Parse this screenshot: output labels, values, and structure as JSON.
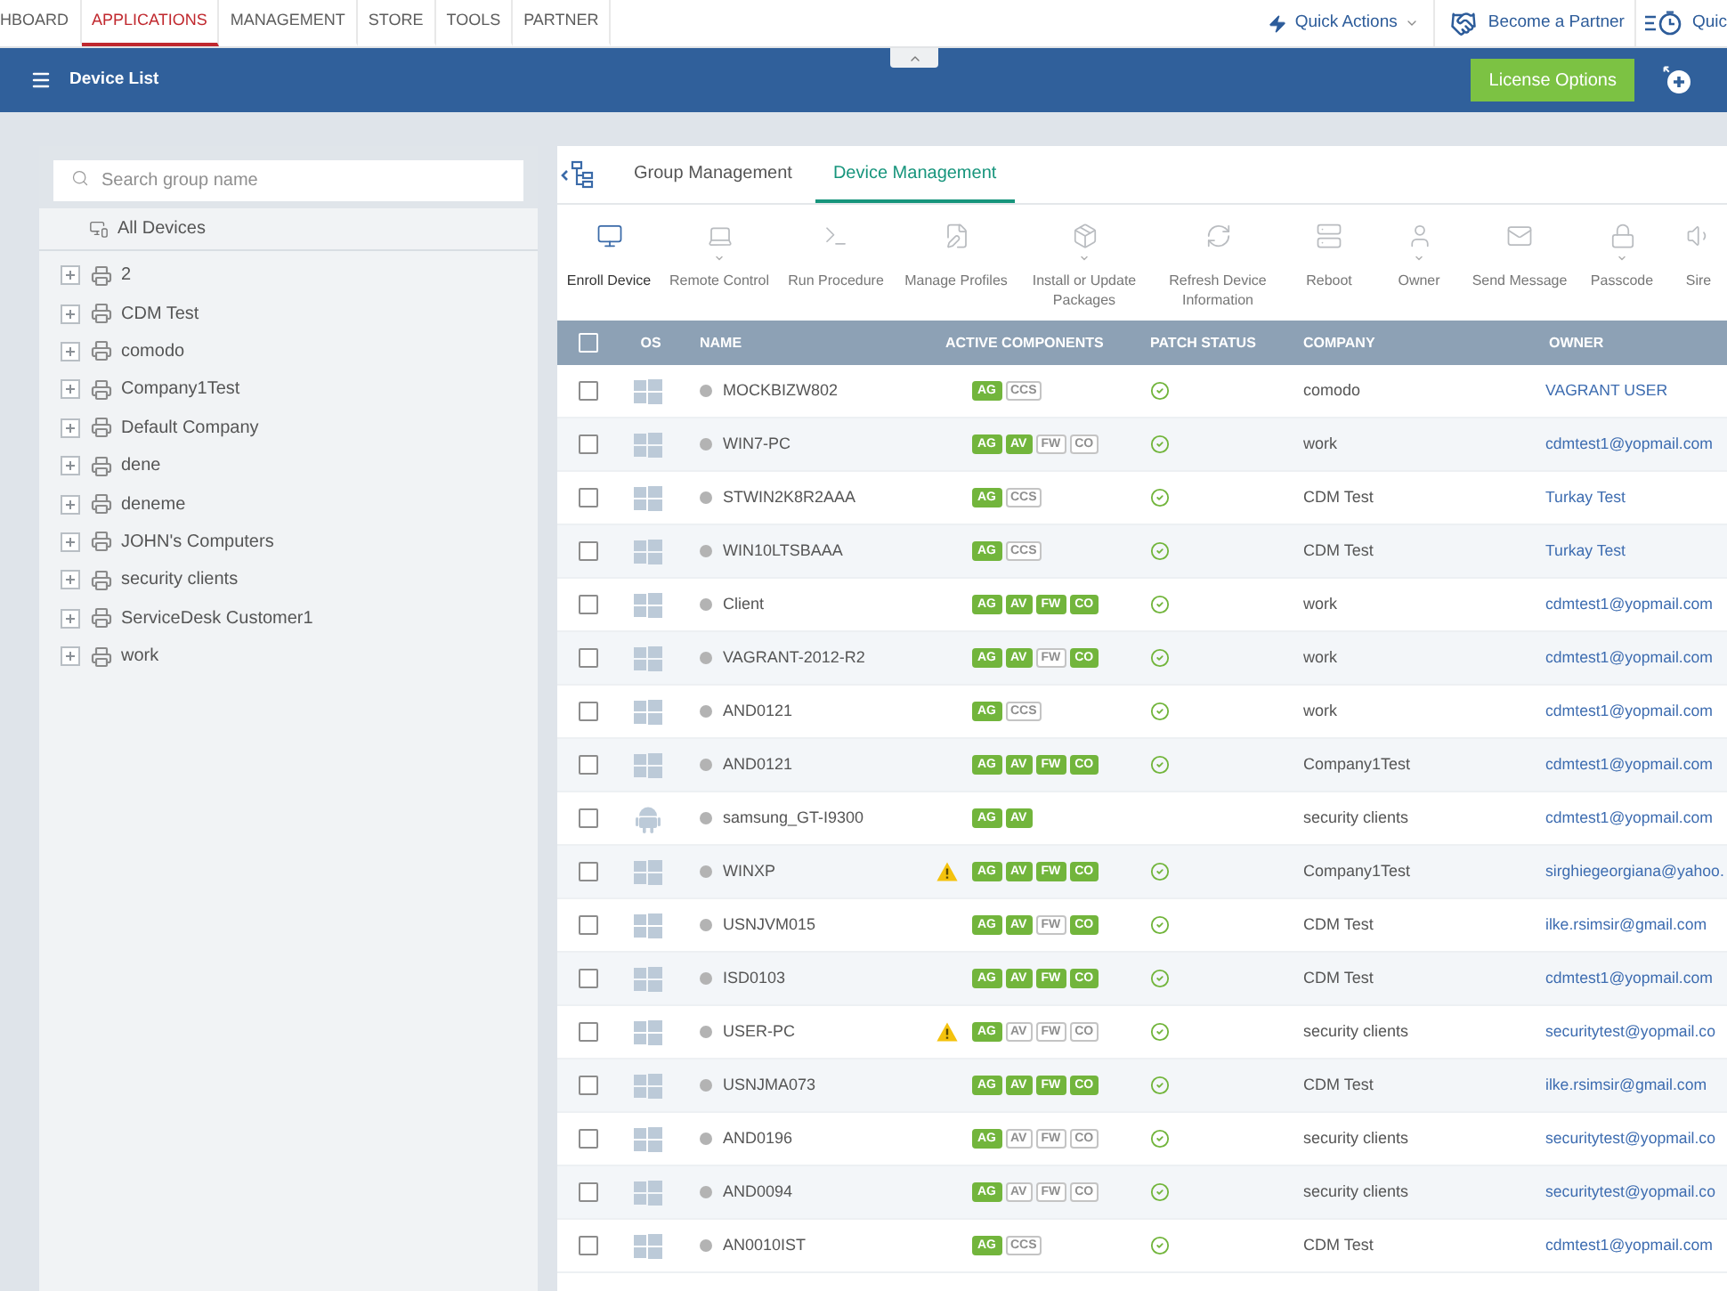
{
  "top_nav": {
    "items": [
      {
        "label": "HBOARD",
        "selected": false
      },
      {
        "label": "APPLICATIONS",
        "selected": true
      },
      {
        "label": "MANAGEMENT",
        "selected": false
      },
      {
        "label": "STORE",
        "selected": false
      },
      {
        "label": "TOOLS",
        "selected": false
      },
      {
        "label": "PARTNER",
        "selected": false
      }
    ],
    "actions": [
      {
        "label": "Quick Actions",
        "dropdown": true
      },
      {
        "label": "Become a Partner",
        "dropdown": false
      },
      {
        "label": "Quic",
        "dropdown": false
      }
    ]
  },
  "title_bar": {
    "title": "Device List",
    "button": "License Options"
  },
  "sidebar": {
    "search": {
      "placeholder": "Search group name"
    },
    "root": "All Devices",
    "groups": [
      {
        "label": "2",
        "expanded": false
      },
      {
        "label": "CDM Test",
        "expanded": false
      },
      {
        "label": "comodo",
        "expanded": false
      },
      {
        "label": "Company1Test",
        "expanded": false
      },
      {
        "label": "Default Company",
        "expanded": false
      },
      {
        "label": "dene",
        "expanded": false
      },
      {
        "label": "deneme",
        "expanded": false
      },
      {
        "label": "JOHN's Computers",
        "expanded": false
      },
      {
        "label": "security clients",
        "expanded": false
      },
      {
        "label": "ServiceDesk Customer1",
        "expanded": false
      },
      {
        "label": "work",
        "expanded": false
      }
    ]
  },
  "tabs": [
    {
      "label": "Group Management",
      "selected": false
    },
    {
      "label": "Device Management",
      "selected": true
    }
  ],
  "toolbar": [
    {
      "label": "Enroll Device",
      "disabled": false,
      "dropdown": false
    },
    {
      "label": "Remote Control",
      "disabled": true,
      "dropdown": true
    },
    {
      "label": "Run Procedure",
      "disabled": true,
      "dropdown": false
    },
    {
      "label": "Manage Profiles",
      "disabled": true,
      "dropdown": false
    },
    {
      "label": "Install or Update Packages",
      "disabled": true,
      "dropdown": true
    },
    {
      "label": "Refresh Device Information",
      "disabled": true,
      "dropdown": false
    },
    {
      "label": "Reboot",
      "disabled": true,
      "dropdown": false
    },
    {
      "label": "Owner",
      "disabled": true,
      "dropdown": true
    },
    {
      "label": "Send Message",
      "disabled": true,
      "dropdown": false
    },
    {
      "label": "Passcode",
      "disabled": true,
      "dropdown": true
    },
    {
      "label": "Sire",
      "disabled": true,
      "dropdown": false
    }
  ],
  "table": {
    "select_all": false,
    "columns": [
      "OS",
      "NAME",
      "ACTIVE COMPONENTS",
      "PATCH STATUS",
      "COMPANY",
      "OWNER"
    ],
    "rows": [
      {
        "checked": false,
        "kind": "windows",
        "online": false,
        "name": "MOCKBIZW802",
        "warning": false,
        "components": [
          {
            "label": "AG",
            "active": true
          },
          {
            "label": "CCS",
            "active": false
          }
        ],
        "patch_ok": true,
        "company": "comodo",
        "owner": "VAGRANT USER"
      },
      {
        "checked": false,
        "kind": "windows",
        "online": false,
        "name": "WIN7-PC",
        "warning": false,
        "components": [
          {
            "label": "AG",
            "active": true
          },
          {
            "label": "AV",
            "active": true
          },
          {
            "label": "FW",
            "active": false
          },
          {
            "label": "CO",
            "active": false
          }
        ],
        "patch_ok": true,
        "company": "work",
        "owner": "cdmtest1@yopmail.com"
      },
      {
        "checked": false,
        "kind": "windows",
        "online": false,
        "name": "STWIN2K8R2AAA",
        "warning": false,
        "components": [
          {
            "label": "AG",
            "active": true
          },
          {
            "label": "CCS",
            "active": false
          }
        ],
        "patch_ok": true,
        "company": "CDM Test",
        "owner": "Turkay Test"
      },
      {
        "checked": false,
        "kind": "windows",
        "online": false,
        "name": "WIN10LTSBAAA",
        "warning": false,
        "components": [
          {
            "label": "AG",
            "active": true
          },
          {
            "label": "CCS",
            "active": false
          }
        ],
        "patch_ok": true,
        "company": "CDM Test",
        "owner": "Turkay Test"
      },
      {
        "checked": false,
        "kind": "windows",
        "online": false,
        "name": "Client",
        "warning": false,
        "components": [
          {
            "label": "AG",
            "active": true
          },
          {
            "label": "AV",
            "active": true
          },
          {
            "label": "FW",
            "active": true
          },
          {
            "label": "CO",
            "active": true
          }
        ],
        "patch_ok": true,
        "company": "work",
        "owner": "cdmtest1@yopmail.com"
      },
      {
        "checked": false,
        "kind": "windows",
        "online": false,
        "name": "VAGRANT-2012-R2",
        "warning": false,
        "components": [
          {
            "label": "AG",
            "active": true
          },
          {
            "label": "AV",
            "active": true
          },
          {
            "label": "FW",
            "active": false
          },
          {
            "label": "CO",
            "active": true
          }
        ],
        "patch_ok": true,
        "company": "work",
        "owner": "cdmtest1@yopmail.com"
      },
      {
        "checked": false,
        "kind": "windows",
        "online": false,
        "name": "AND0121",
        "warning": false,
        "components": [
          {
            "label": "AG",
            "active": true
          },
          {
            "label": "CCS",
            "active": false
          }
        ],
        "patch_ok": true,
        "company": "work",
        "owner": "cdmtest1@yopmail.com"
      },
      {
        "checked": false,
        "kind": "windows",
        "online": false,
        "name": "AND0121",
        "warning": false,
        "components": [
          {
            "label": "AG",
            "active": true
          },
          {
            "label": "AV",
            "active": true
          },
          {
            "label": "FW",
            "active": true
          },
          {
            "label": "CO",
            "active": true
          }
        ],
        "patch_ok": true,
        "company": "Company1Test",
        "owner": "cdmtest1@yopmail.com"
      },
      {
        "checked": false,
        "kind": "android",
        "online": false,
        "name": "samsung_GT-I9300",
        "warning": false,
        "components": [
          {
            "label": "AG",
            "active": true
          },
          {
            "label": "AV",
            "active": true
          }
        ],
        "patch_ok": false,
        "company": "security clients",
        "owner": "cdmtest1@yopmail.com"
      },
      {
        "checked": false,
        "kind": "windows",
        "online": false,
        "name": "WINXP",
        "warning": true,
        "components": [
          {
            "label": "AG",
            "active": true
          },
          {
            "label": "AV",
            "active": true
          },
          {
            "label": "FW",
            "active": true
          },
          {
            "label": "CO",
            "active": true
          }
        ],
        "patch_ok": true,
        "company": "Company1Test",
        "owner": "sirghiegeorgiana@yahoo."
      },
      {
        "checked": false,
        "kind": "windows",
        "online": false,
        "name": "USNJVM015",
        "warning": false,
        "components": [
          {
            "label": "AG",
            "active": true
          },
          {
            "label": "AV",
            "active": true
          },
          {
            "label": "FW",
            "active": false
          },
          {
            "label": "CO",
            "active": true
          }
        ],
        "patch_ok": true,
        "company": "CDM Test",
        "owner": "ilke.rsimsir@gmail.com"
      },
      {
        "checked": false,
        "kind": "windows",
        "online": false,
        "name": "ISD0103",
        "warning": false,
        "components": [
          {
            "label": "AG",
            "active": true
          },
          {
            "label": "AV",
            "active": true
          },
          {
            "label": "FW",
            "active": true
          },
          {
            "label": "CO",
            "active": true
          }
        ],
        "patch_ok": true,
        "company": "CDM Test",
        "owner": "cdmtest1@yopmail.com"
      },
      {
        "checked": false,
        "kind": "windows",
        "online": false,
        "name": "USER-PC",
        "warning": true,
        "components": [
          {
            "label": "AG",
            "active": true
          },
          {
            "label": "AV",
            "active": false
          },
          {
            "label": "FW",
            "active": false
          },
          {
            "label": "CO",
            "active": false
          }
        ],
        "patch_ok": true,
        "company": "security clients",
        "owner": "securitytest@yopmail.co"
      },
      {
        "checked": false,
        "kind": "windows",
        "online": false,
        "name": "USNJMA073",
        "warning": false,
        "components": [
          {
            "label": "AG",
            "active": true
          },
          {
            "label": "AV",
            "active": true
          },
          {
            "label": "FW",
            "active": true
          },
          {
            "label": "CO",
            "active": true
          }
        ],
        "patch_ok": true,
        "company": "CDM Test",
        "owner": "ilke.rsimsir@gmail.com"
      },
      {
        "checked": false,
        "kind": "windows",
        "online": false,
        "name": "AND0196",
        "warning": false,
        "components": [
          {
            "label": "AG",
            "active": true
          },
          {
            "label": "AV",
            "active": false
          },
          {
            "label": "FW",
            "active": false
          },
          {
            "label": "CO",
            "active": false
          }
        ],
        "patch_ok": true,
        "company": "security clients",
        "owner": "securitytest@yopmail.co"
      },
      {
        "checked": false,
        "kind": "windows",
        "online": false,
        "name": "AND0094",
        "warning": false,
        "components": [
          {
            "label": "AG",
            "active": true
          },
          {
            "label": "AV",
            "active": false
          },
          {
            "label": "FW",
            "active": false
          },
          {
            "label": "CO",
            "active": false
          }
        ],
        "patch_ok": true,
        "company": "security clients",
        "owner": "securitytest@yopmail.co"
      },
      {
        "checked": false,
        "kind": "windows",
        "online": false,
        "name": "AN0010IST",
        "warning": false,
        "components": [
          {
            "label": "AG",
            "active": true
          },
          {
            "label": "CCS",
            "active": false
          }
        ],
        "patch_ok": true,
        "company": "CDM Test",
        "owner": "cdmtest1@yopmail.com"
      }
    ]
  }
}
